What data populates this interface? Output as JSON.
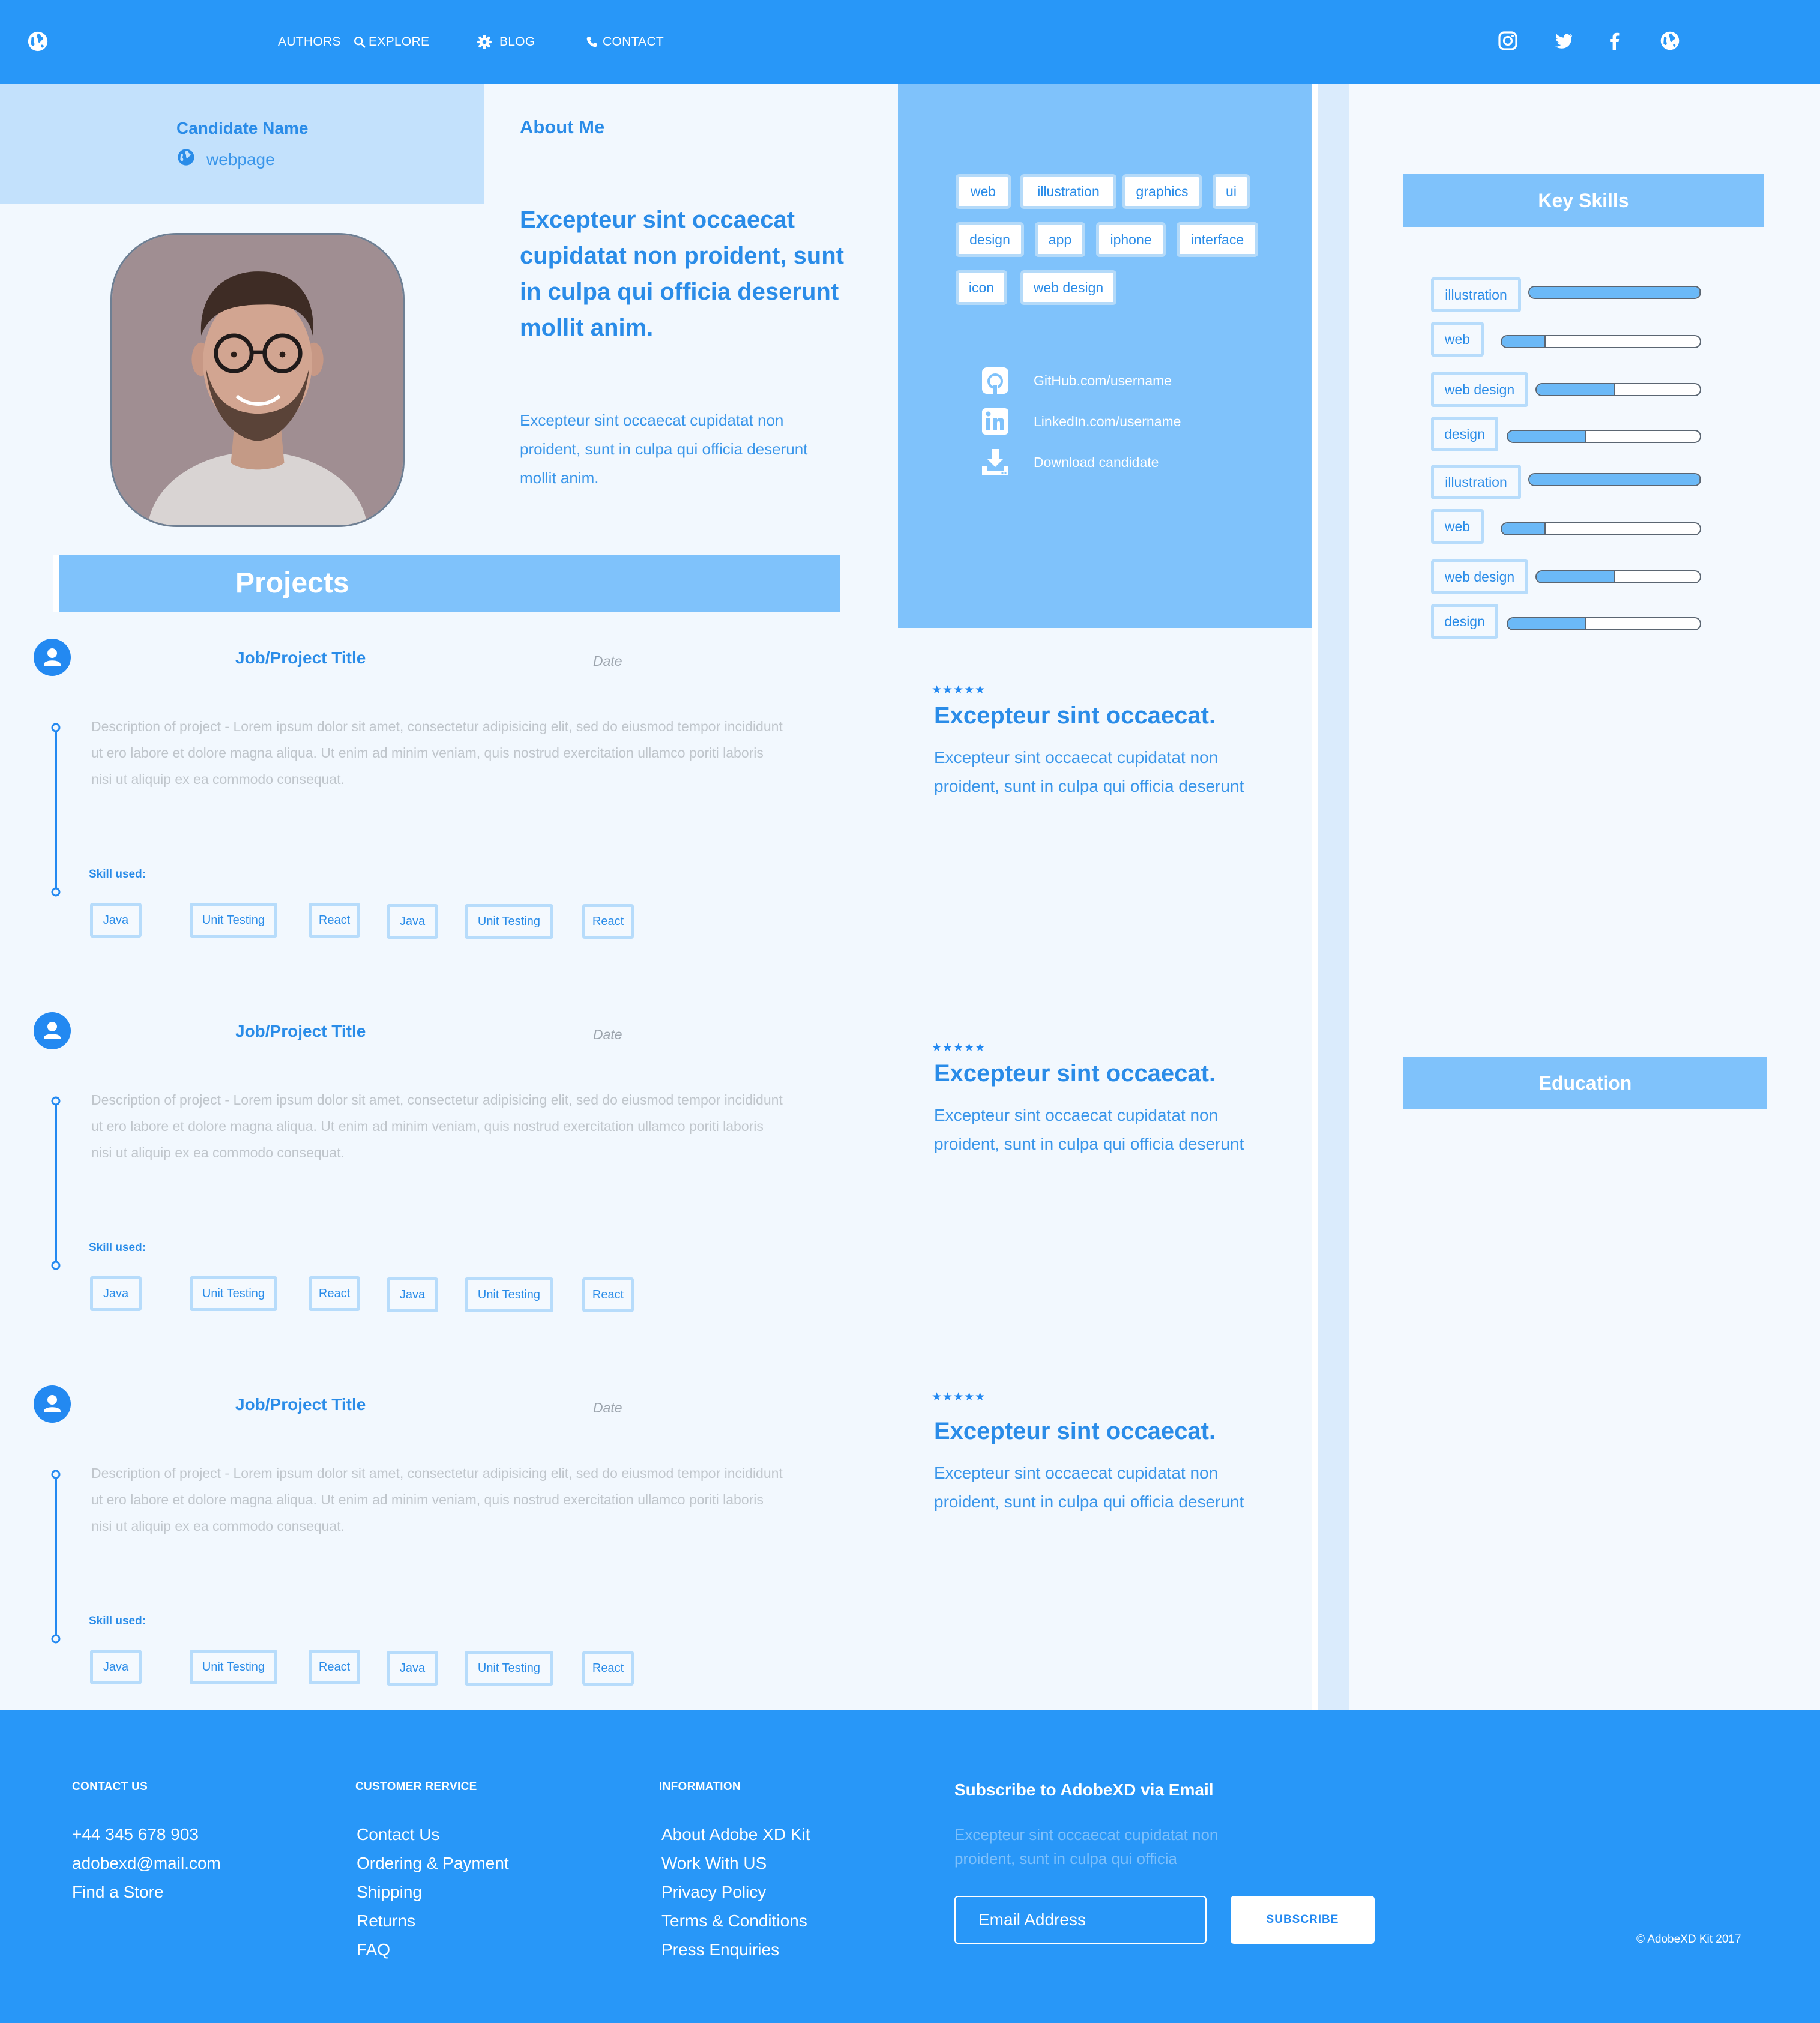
{
  "nav": {
    "logo_icon": "globe-icon",
    "links": [
      {
        "label": "AUTHORS",
        "icon": ""
      },
      {
        "label": "EXPLORE",
        "icon": "search-icon"
      },
      {
        "label": "BLOG",
        "icon": "gear-icon"
      },
      {
        "label": "CONTACT",
        "icon": "phone-icon"
      }
    ],
    "social_icons": [
      "instagram-icon",
      "twitter-icon",
      "facebook-icon",
      "globe-icon"
    ]
  },
  "candidate": {
    "name": "Candidate Name",
    "webpage": "webpage"
  },
  "about": {
    "title": "About Me",
    "lead": "Excepteur sint occaecat cupidatat non proident, sunt in culpa qui officia deserunt mollit anim.",
    "body": "Excepteur sint occaecat cupidatat non proident, sunt in culpa qui officia deserunt mollit anim."
  },
  "tags": [
    "web",
    "illustration",
    "graphics",
    "ui",
    "design",
    "app",
    "iphone",
    "interface",
    "icon",
    "web design"
  ],
  "links": [
    {
      "icon": "github-icon",
      "label": "GitHub.com/username"
    },
    {
      "icon": "linkedin-icon",
      "label": "LinkedIn.com/username"
    },
    {
      "icon": "download-icon",
      "label": "Download candidate"
    }
  ],
  "projects": {
    "title": "Projects",
    "items": [
      {
        "title": "Job/Project Title",
        "date": "Date",
        "description": "Description of project - Lorem ipsum dolor sit amet, consectetur adipisicing elit, sed do eiusmod tempor incididunt ut ero labore et dolore magna aliqua. Ut enim ad minim veniam, quis nostrud exercitation ullamco poriti laboris nisi ut aliquip ex ea commodo consequat.",
        "skills_label": "Skill used:",
        "skills": [
          "Java",
          "Unit Testing",
          "React",
          "Java",
          "Unit Testing",
          "React"
        ]
      },
      {
        "title": "Job/Project Title",
        "date": "Date",
        "description": "Description of project - Lorem ipsum dolor sit amet, consectetur adipisicing elit, sed do eiusmod tempor incididunt ut ero labore et dolore magna aliqua. Ut enim ad minim veniam, quis nostrud exercitation ullamco poriti laboris nisi ut aliquip ex ea commodo consequat.",
        "skills_label": "Skill used:",
        "skills": [
          "Java",
          "Unit Testing",
          "React",
          "Java",
          "Unit Testing",
          "React"
        ]
      },
      {
        "title": "Job/Project Title",
        "date": "Date",
        "description": "Description of project - Lorem ipsum dolor sit amet, consectetur adipisicing elit, sed do eiusmod tempor incididunt ut ero labore et dolore magna aliqua. Ut enim ad minim veniam, quis nostrud exercitation ullamco poriti laboris nisi ut aliquip ex ea commodo consequat.",
        "skills_label": "Skill used:",
        "skills": [
          "Java",
          "Unit Testing",
          "React",
          "Java",
          "Unit Testing",
          "React"
        ]
      }
    ]
  },
  "reviews": [
    {
      "stars": "★★★★★",
      "title": "Excepteur sint occaecat.",
      "body": "Excepteur sint occaecat cupidatat non proident, sunt in culpa qui officia deserunt"
    },
    {
      "stars": "★★★★★",
      "title": "Excepteur sint occaecat.",
      "body": "Excepteur sint occaecat cupidatat non proident, sunt in culpa qui officia deserunt"
    },
    {
      "stars": "★★★★★",
      "title": "Excepteur sint occaecat.",
      "body": "Excepteur sint occaecat cupidatat non proident, sunt in culpa qui officia deserunt"
    }
  ],
  "key_skills": {
    "title": "Key Skills",
    "items": [
      {
        "label": "illustration",
        "level": 1.0
      },
      {
        "label": "web",
        "level": 0.22
      },
      {
        "label": "web design",
        "level": 0.48
      },
      {
        "label": "design",
        "level": 0.41
      },
      {
        "label": "illustration",
        "level": 1.0
      },
      {
        "label": "web",
        "level": 0.22
      },
      {
        "label": "web design",
        "level": 0.48
      },
      {
        "label": "design",
        "level": 0.41
      }
    ]
  },
  "education": {
    "title": "Education"
  },
  "footer": {
    "columns": [
      {
        "heading": "CONTACT US",
        "items": [
          "+44 345 678 903",
          "adobexd@mail.com",
          "Find a Store"
        ]
      },
      {
        "heading": "CUSTOMER RERVICE",
        "items": [
          "Contact Us",
          "Ordering & Payment",
          "Shipping",
          "Returns",
          "FAQ"
        ]
      },
      {
        "heading": "INFORMATION",
        "items": [
          "About Adobe XD Kit",
          "Work With US",
          "Privacy Policy",
          "Terms & Conditions",
          "Press Enquiries"
        ]
      }
    ],
    "subscribe": {
      "heading": "Subscribe to AdobeXD via Email",
      "body": "Excepteur sint occaecat cupidatat non proident, sunt in culpa qui officia",
      "placeholder": "Email Address",
      "button": "SUBSCRIBE"
    },
    "copyright": "© AdobeXD Kit 2017"
  },
  "colors": {
    "primary": "#2897f8",
    "light_panel": "#7fc2fb",
    "pale_panel": "#c3e1fc",
    "text_blue": "#2a8ce8",
    "background": "#f2f8fe"
  }
}
